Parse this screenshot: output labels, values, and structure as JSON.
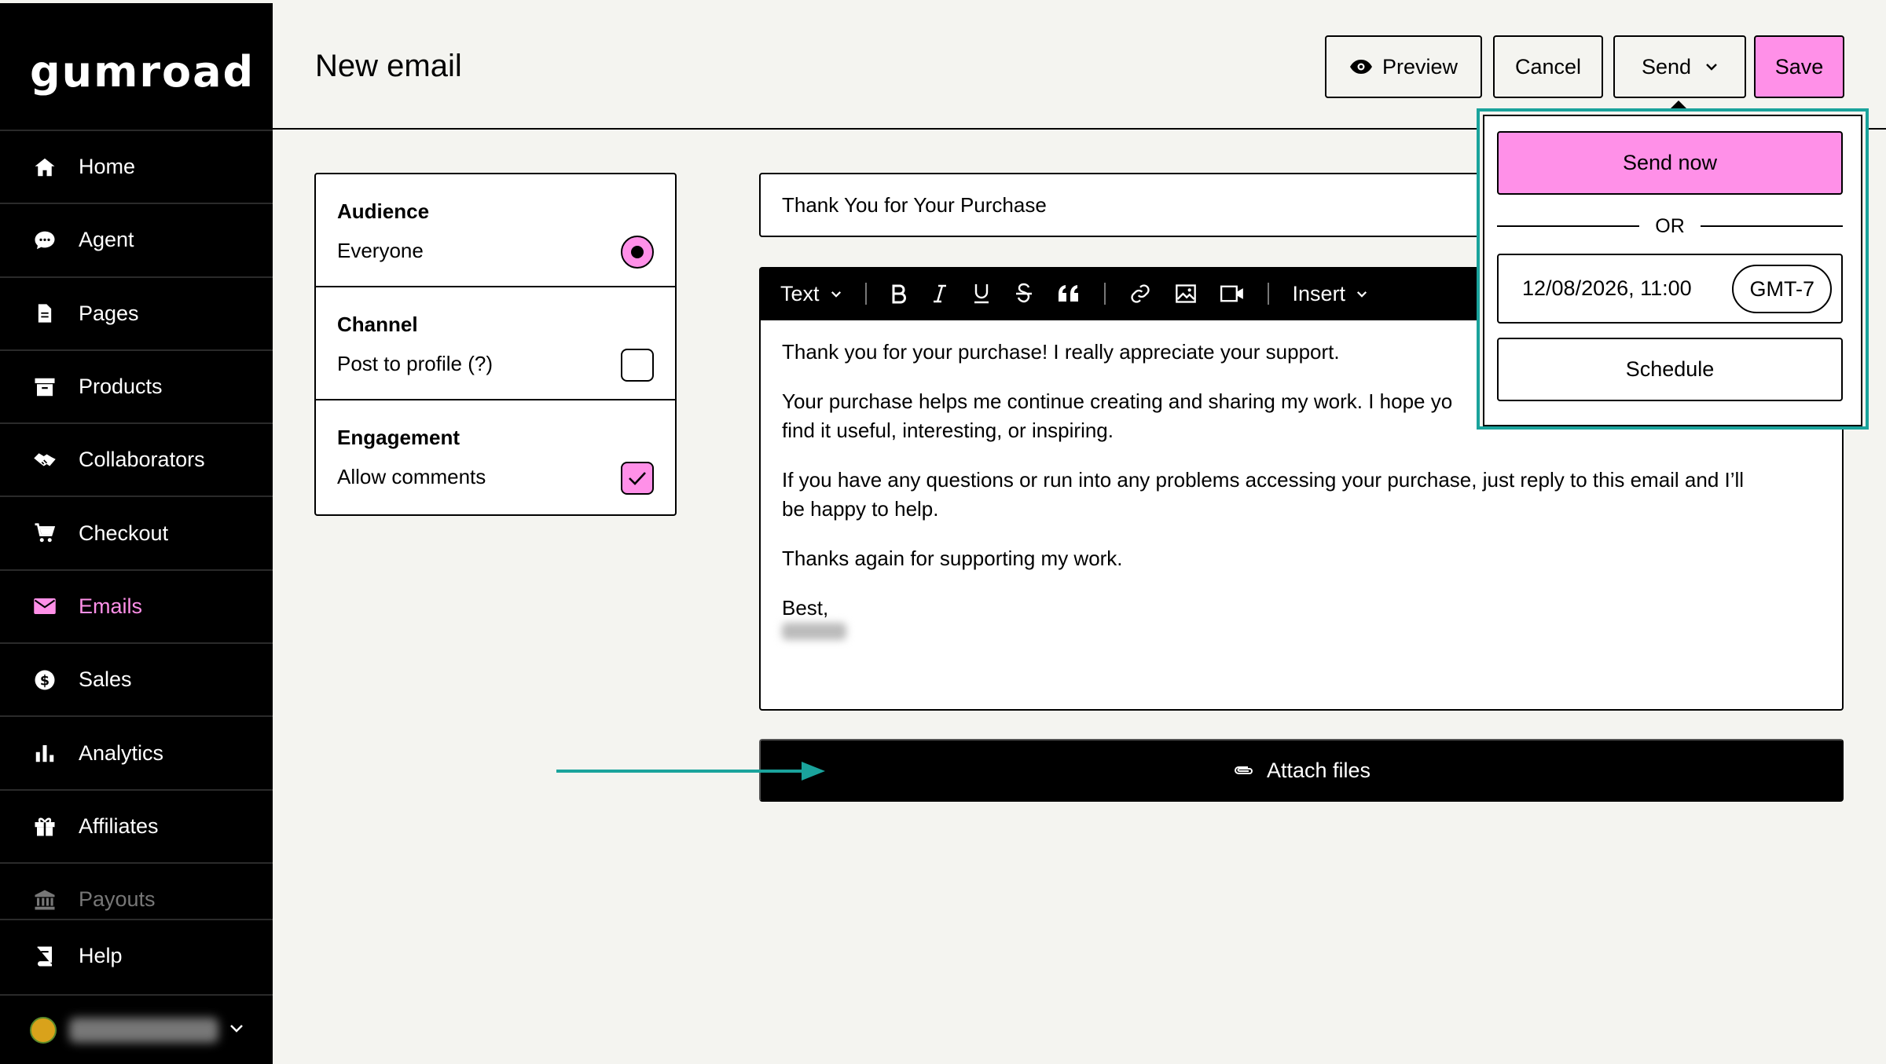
{
  "app": {
    "logo": "gumroad"
  },
  "sidebar": {
    "items": [
      {
        "label": "Home",
        "icon": "home-icon"
      },
      {
        "label": "Agent",
        "icon": "chat-bubble-icon"
      },
      {
        "label": "Pages",
        "icon": "document-icon"
      },
      {
        "label": "Products",
        "icon": "archive-box-icon"
      },
      {
        "label": "Collaborators",
        "icon": "handshake-icon"
      },
      {
        "label": "Checkout",
        "icon": "cart-icon"
      },
      {
        "label": "Emails",
        "icon": "envelope-icon",
        "active": true
      },
      {
        "label": "Sales",
        "icon": "dollar-circle-icon"
      },
      {
        "label": "Analytics",
        "icon": "bar-chart-icon"
      },
      {
        "label": "Affiliates",
        "icon": "gift-icon"
      },
      {
        "label": "Payouts",
        "icon": "bank-icon"
      }
    ],
    "help": "Help"
  },
  "header": {
    "title": "New email",
    "preview_label": "Preview",
    "cancel_label": "Cancel",
    "send_label": "Send",
    "save_label": "Save"
  },
  "settings": {
    "audience": {
      "label": "Audience",
      "value": "Everyone"
    },
    "channel": {
      "label": "Channel",
      "value": "Post to profile  (?)"
    },
    "engagement": {
      "label": "Engagement",
      "value": "Allow comments"
    }
  },
  "email": {
    "subject": "Thank You for Your Purchase",
    "body": [
      "Thank you for your purchase! I really appreciate your support.",
      "Your purchase helps me continue creating and sharing my work. I hope yo",
      "find it useful, interesting, or inspiring.",
      "If you have any questions or run into any problems accessing your purchase, just reply to this email and I’ll",
      "be happy to help.",
      "Thanks again for supporting my work.",
      "Best,"
    ]
  },
  "toolbar": {
    "text_label": "Text",
    "insert_label": "Insert"
  },
  "attach": {
    "label": "Attach files"
  },
  "send_menu": {
    "send_now_label": "Send now",
    "or_label": "OR",
    "datetime": "12/08/2026, 11:00",
    "timezone": "GMT-7",
    "schedule_label": "Schedule"
  },
  "colors": {
    "accent": "#ff90e8",
    "annotation": "#1aa39c",
    "sidebar_bg": "#000000",
    "page_bg": "#f4f4f0"
  }
}
